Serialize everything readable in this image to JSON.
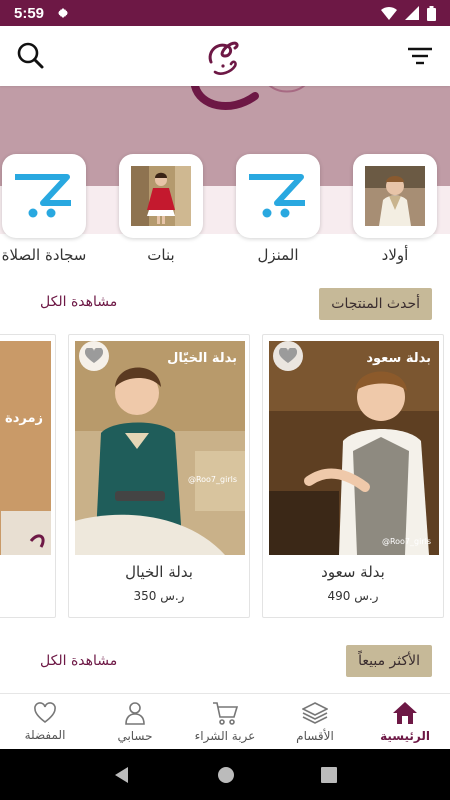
{
  "status_bar": {
    "time": "5:59"
  },
  "categories": [
    {
      "label": "أولاد",
      "icon": "boy-photo"
    },
    {
      "label": "المنزل",
      "icon": "cart-logo-icon"
    },
    {
      "label": "بنات",
      "icon": "girl-photo"
    },
    {
      "label": "سجادة الصلاة",
      "icon": "cart-logo-icon"
    }
  ],
  "section_new": {
    "title": "أحدث المنتجات",
    "see_all": "مشاهدة الكل"
  },
  "products": [
    {
      "name": "بدلة سعود",
      "price": "490 ر.س",
      "photo_title": "بدلة سعود",
      "watermark": "@Roo7_girls"
    },
    {
      "name": "بدلة الخيال",
      "price": "350 ر.س",
      "photo_title": "بدلة الخيّال",
      "watermark": "@Roo7_girls"
    },
    {
      "name": "",
      "price": "",
      "photo_title": "زمردة",
      "watermark": ""
    }
  ],
  "section_best": {
    "title": "الأكثر مبيعاً",
    "see_all": "مشاهدة الكل"
  },
  "bottom_nav": [
    {
      "label": "الرئيسية",
      "icon": "home-icon",
      "active": true
    },
    {
      "label": "الأقسام",
      "icon": "layers-icon",
      "active": false
    },
    {
      "label": "عربة الشراء",
      "icon": "cart-icon",
      "active": false
    },
    {
      "label": "حسابي",
      "icon": "user-icon",
      "active": false
    },
    {
      "label": "المفضلة",
      "icon": "heart-icon",
      "active": false
    }
  ],
  "colors": {
    "brand": "#6d1845",
    "accent_pill": "#c6b998",
    "banner": "#c09ca6",
    "cart_logo": "#29a8e0"
  }
}
